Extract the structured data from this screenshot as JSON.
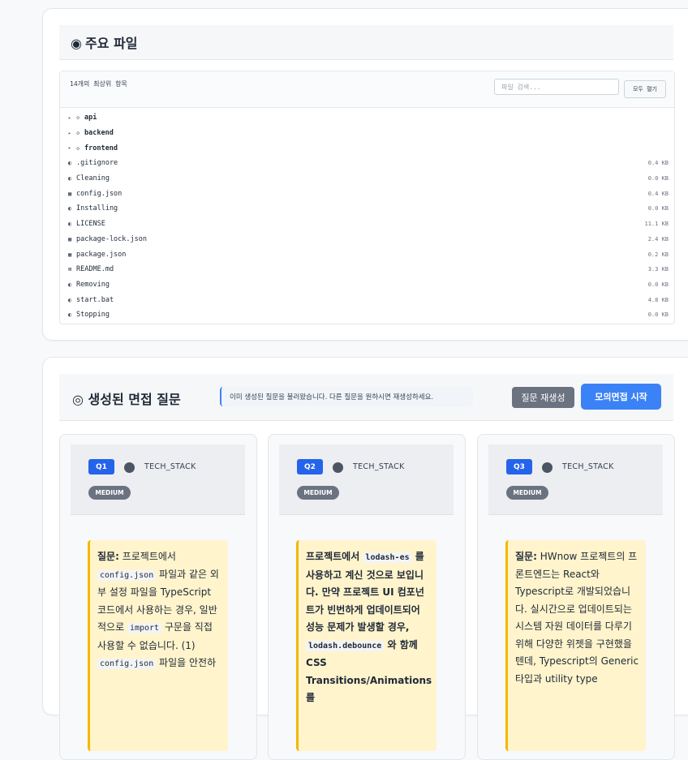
{
  "files_section": {
    "icon": "◉",
    "title": "주요 파일",
    "count_text": "14개의 최상위 항목",
    "search_placeholder": "파일 검색...",
    "expand_all_label": "모두 펼기",
    "entries": [
      {
        "type": "dir",
        "arrow": "▸",
        "glyph": "◇",
        "name": "api",
        "size": ""
      },
      {
        "type": "dir",
        "arrow": "▸",
        "glyph": "◇",
        "name": "backend",
        "size": ""
      },
      {
        "type": "dir",
        "arrow": "▸",
        "glyph": "◇",
        "name": "frontend",
        "size": ""
      },
      {
        "type": "file",
        "glyph": "◐",
        "name": ".gitignore",
        "size": "0.4 KB"
      },
      {
        "type": "file",
        "glyph": "◐",
        "name": "Cleaning",
        "size": "0.0 KB"
      },
      {
        "type": "file",
        "glyph": "▦",
        "name": "config.json",
        "size": "0.4 KB"
      },
      {
        "type": "file",
        "glyph": "◐",
        "name": "Installing",
        "size": "0.0 KB"
      },
      {
        "type": "file",
        "glyph": "◐",
        "name": "LICENSE",
        "size": "11.1 KB"
      },
      {
        "type": "file",
        "glyph": "▦",
        "name": "package-lock.json",
        "size": "2.4 KB"
      },
      {
        "type": "file",
        "glyph": "▦",
        "name": "package.json",
        "size": "0.2 KB"
      },
      {
        "type": "file",
        "glyph": "⊠",
        "name": "README.md",
        "size": "3.3 KB"
      },
      {
        "type": "file",
        "glyph": "◐",
        "name": "Removing",
        "size": "0.0 KB"
      },
      {
        "type": "file",
        "glyph": "◐",
        "name": "start.bat",
        "size": "4.8 KB"
      },
      {
        "type": "file",
        "glyph": "◐",
        "name": "Stopping",
        "size": "0.0 KB"
      }
    ]
  },
  "questions_section": {
    "title": "◎ 생성된 면접 질문",
    "notice": "이미 생성된 질문을 불러왔습니다. 다른 질문을 원하시면 재생성하세요.",
    "regenerate_label": "질문 재생성",
    "mock_interview_label": "모의면접 시작",
    "questions": [
      {
        "number": "Q1",
        "category": "TECH_STACK",
        "difficulty": "MEDIUM",
        "label": "질문:",
        "parts": [
          {
            "t": "text",
            "v": " 프로젝트에서 "
          },
          {
            "t": "code",
            "v": "config.json"
          },
          {
            "t": "text",
            "v": " 파일과 같은 외부 설정 파일을 TypeScript 코드에서 사용하는 경우, 일반적으로 "
          },
          {
            "t": "code",
            "v": "import"
          },
          {
            "t": "text",
            "v": " 구문을 직접 사용할 수 없습니다. (1) "
          },
          {
            "t": "code",
            "v": "config.json"
          },
          {
            "t": "text",
            "v": " 파일을 안전하"
          }
        ]
      },
      {
        "number": "Q2",
        "category": "TECH_STACK",
        "difficulty": "MEDIUM",
        "label": "",
        "parts": [
          {
            "t": "text",
            "v": "프로젝트에서 "
          },
          {
            "t": "code",
            "v": "lodash-es"
          },
          {
            "t": "text",
            "v": " 를 사용하고 계신 것으로 보입니다. 만약 프로젝트 UI 컴포넌트가 빈번하게 업데이트되어 성능 문제가 발생할 경우, "
          },
          {
            "t": "code",
            "v": "lodash.debounce"
          },
          {
            "t": "text",
            "v": " 와 함께 CSS Transitions/Animations를"
          }
        ]
      },
      {
        "number": "Q3",
        "category": "TECH_STACK",
        "difficulty": "MEDIUM",
        "label": "질문:",
        "parts": [
          {
            "t": "text",
            "v": " HWnow 프로젝트의 프론트엔드는 React와 Typescript로 개발되었습니다. 실시간으로 업데이트되는 시스템 자원 데이터를 다루기 위해 다양한 위젯을 구현했을 텐데, Typescript의 Generic 타입과 utility type"
          }
        ]
      }
    ]
  },
  "colors": {
    "accent": "#3b82f6",
    "badge_blue": "#2563eb",
    "secondary": "#6b7280",
    "question_bg": "#fff4cc",
    "question_border": "#f5b700"
  }
}
